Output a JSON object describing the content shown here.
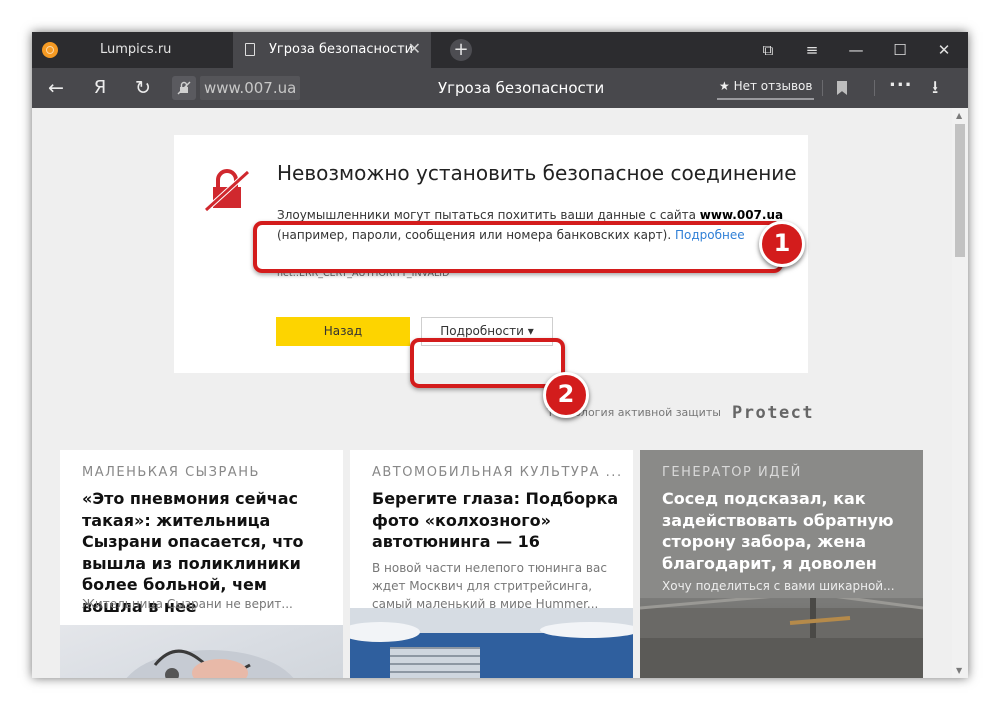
{
  "tabs": [
    {
      "title": "Lumpics.ru"
    },
    {
      "title": "Угроза безопасности"
    }
  ],
  "toolbar": {
    "new_tab": "+",
    "back_icon": "←",
    "yandex_logo": "Я",
    "reload_icon": "↻",
    "url": "www.007.ua",
    "page_title": "Угроза безопасности",
    "reviews": "★ Нет отзывов",
    "menu_dots": "...",
    "download_icon": "⭳"
  },
  "window_controls": {
    "bookmarks": "⧉",
    "menu": "≡",
    "minimize": "—",
    "maximize": "☐",
    "close": "✕"
  },
  "error": {
    "title": "Невозможно установить безопасное соединение",
    "desc_before": "Злоумышленники могут пытаться похитить ваши данные с сайта ",
    "site": "www.007.ua",
    "desc_after": " (например, пароли, сообщения или номера банковских карт). ",
    "more_link": "Подробнее",
    "code": "net::ERR_CERT_AUTHORITY_INVALID",
    "back_button": "Назад",
    "details_button": "Подробности ▾"
  },
  "annotations": {
    "badge_1": "1",
    "badge_2": "2"
  },
  "protect": {
    "label": "Технология активной защиты",
    "logo": "Protect"
  },
  "news": [
    {
      "source": "Маленькая Сызрань",
      "headline": "«Это пневмония сейчас такая»: жительница Сызрани опасается, что вышла из поликлиники более больной, чем вошла в нее",
      "snippet": "Жительница Сызрани не верит..."
    },
    {
      "source": "Автомобильная культура ...",
      "headline": "Берегите глаза: Подборка фото «колхозного» автотюнинга — 16",
      "snippet": "В новой части нелепого тюнинга вас ждет Москвич для стритрейсинга, самый маленький в мире Hummer..."
    },
    {
      "source": "Генератор идей",
      "headline": "Сосед подсказал, как задействовать обратную сторону забора, жена благодарит, я доволен",
      "snippet": "Хочу поделиться с вами шикарной..."
    }
  ],
  "colors": {
    "accent_yellow": "#fdd400",
    "annotation_red": "#d31c1c",
    "link_blue": "#2f7fd6",
    "lock_red": "#d0282e"
  }
}
